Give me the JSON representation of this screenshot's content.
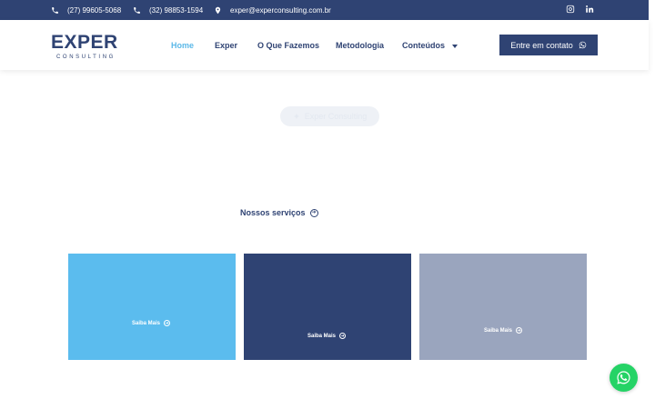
{
  "topbar": {
    "phone1": "(27) 99605-5068",
    "phone2": "(32) 98853-1594",
    "email": "exper@experconsulting.com.br",
    "social": [
      "instagram-icon",
      "linkedin-icon"
    ]
  },
  "logo": {
    "main": "EXPER",
    "sub": "CONSULTING"
  },
  "nav": {
    "items": [
      "Home",
      "Exper",
      "O Que Fazemos",
      "Metodologia",
      "Conteúdos"
    ],
    "active": "Home"
  },
  "cta": {
    "label": "Entre em contato"
  },
  "hero": {
    "pill": "Exper Consulting"
  },
  "services": {
    "label": "Nossos serviços",
    "cards": [
      {
        "link": "Saiba Mais",
        "color": "#5bbcee"
      },
      {
        "link": "Saiba Mais",
        "color": "#2f4373"
      },
      {
        "link": "Saiba Mais",
        "color": "#9aa5be"
      }
    ]
  },
  "colors": {
    "brand": "#2f4373",
    "accent": "#5bb8e8",
    "whatsapp": "#25d366"
  }
}
